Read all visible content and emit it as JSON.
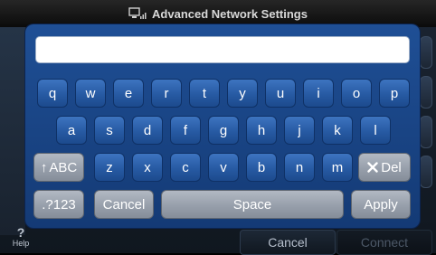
{
  "window": {
    "title": "Advanced Network Settings"
  },
  "keyboard": {
    "text_value": "",
    "rows": [
      [
        "q",
        "w",
        "e",
        "r",
        "t",
        "y",
        "u",
        "i",
        "o",
        "p"
      ],
      [
        "a",
        "s",
        "d",
        "f",
        "g",
        "h",
        "j",
        "k",
        "l"
      ],
      [
        "z",
        "x",
        "c",
        "v",
        "b",
        "n",
        "m"
      ]
    ],
    "shift_label": "ABC",
    "delete_label": "Del",
    "mode_label": ".?123",
    "cancel_label": "Cancel",
    "space_label": "Space",
    "apply_label": "Apply"
  },
  "footer": {
    "help_label": "Help",
    "cancel_label": "Cancel",
    "connect_label": "Connect"
  },
  "colors": {
    "keyboard_bg": "#1d4a8c",
    "letter_key": "#2b5fa8",
    "action_key": "#9aa2ad"
  }
}
